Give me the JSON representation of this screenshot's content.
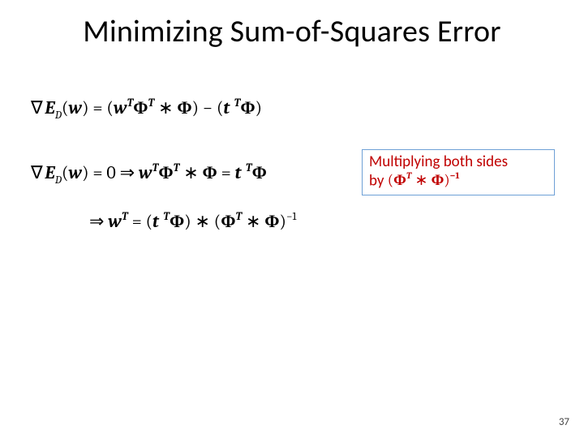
{
  "slide": {
    "title": "Minimizing Sum-of-Squares Error",
    "page_number": "37"
  },
  "equations": {
    "eq1": {
      "grad": "∇",
      "E": "E",
      "D": "D",
      "lp": "(",
      "w": "w",
      "rp": ")",
      "eq": " = ",
      "lp2": "(",
      "w2": "w",
      "T1": "T",
      "Phi1": "Φ",
      "T2": "T",
      "star1": " ∗ ",
      "Phi2": "Φ",
      "rp2": ")",
      "minus": " − ",
      "lp3": "(",
      "t": "t",
      "T3": "T",
      "Phi3": "Φ",
      "rp3": ")"
    },
    "eq2": {
      "grad": "∇",
      "E": "E",
      "D": "D",
      "lp": "(",
      "w": "w",
      "rp": ")",
      "eq": " = 0 ",
      "impl": "⇒",
      "sp": " ",
      "w2": "w",
      "T1": "T",
      "Phi1": "Φ",
      "T2": "T",
      "star1": " ∗ ",
      "Phi2": "Φ",
      "eq2": " = ",
      "t": "t",
      "T3": "T",
      "Phi3": "Φ"
    },
    "eq3": {
      "impl": "⇒",
      "sp": " ",
      "w": "w",
      "T1": "T",
      "eq": " = ",
      "lp1": "(",
      "t": "t",
      "T2": "T",
      "Phi1": "Φ",
      "rp1": ")",
      "star1": " ∗ ",
      "lp2": "(",
      "Phi2": "Φ",
      "T3": "T",
      "star2": " ∗ ",
      "Phi3": "Φ",
      "rp2": ")",
      "inv": "−1"
    }
  },
  "annotation": {
    "line1": "Multiplying both sides",
    "by": "by ",
    "lp": "(",
    "Phi1": "Φ",
    "T1": "T",
    "star": " ∗ ",
    "Phi2": "Φ",
    "rp": ")",
    "inv": "−1"
  }
}
